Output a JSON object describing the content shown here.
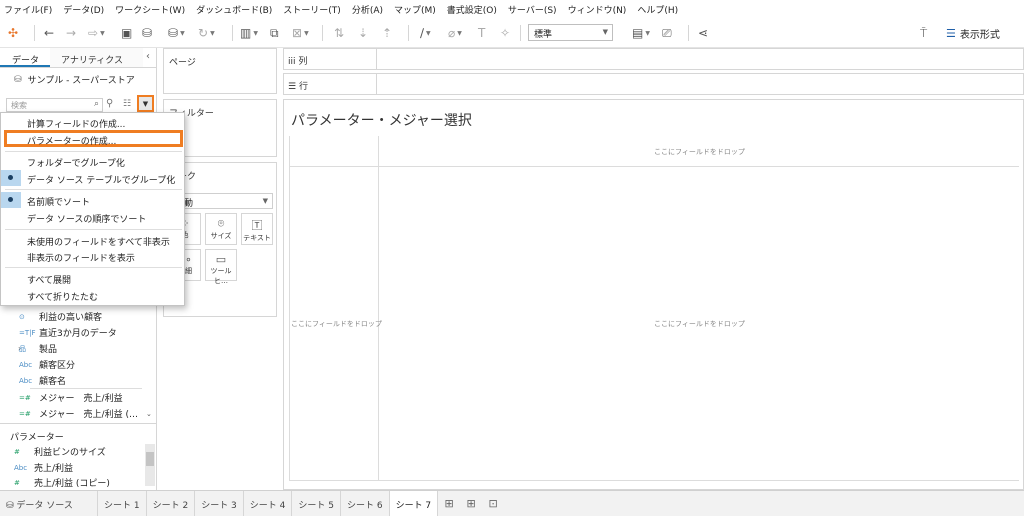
{
  "menubar": [
    "ファイル(F)",
    "データ(D)",
    "ワークシート(W)",
    "ダッシュボード(B)",
    "ストーリー(T)",
    "分析(A)",
    "マップ(M)",
    "書式設定(O)",
    "サーバー(S)",
    "ウィンドウ(N)",
    "ヘルプ(H)"
  ],
  "toolbar": {
    "standard": "標準",
    "display_format": "表示形式"
  },
  "left_panel": {
    "tab_data": "データ",
    "tab_analytics": "アナリティクス",
    "data_source": "サンプル - スーパーストア",
    "search_placeholder": "検索"
  },
  "fields": [
    {
      "icon": "⊙",
      "label": "利益の高い顧客"
    },
    {
      "icon": "=T|F",
      "label": "直近3か月のデータ"
    },
    {
      "icon": "品",
      "label": "製品"
    },
    {
      "icon": "Abc",
      "label": "顧客区分"
    },
    {
      "icon": "Abc",
      "label": "顧客名"
    },
    {
      "icon": "=#",
      "label": "メジャー　売上/利益"
    },
    {
      "icon": "=#",
      "label": "メジャー　売上/利益 (…"
    }
  ],
  "parameters": {
    "title": "パラメーター",
    "items": [
      {
        "icon": "#",
        "label": "利益ビンのサイズ"
      },
      {
        "icon": "Abc",
        "label": "売上/利益"
      },
      {
        "icon": "#",
        "label": "売上/利益 (コピー)"
      }
    ]
  },
  "cards": {
    "pages": "ページ",
    "filters": "フィルター",
    "marks": "マーク",
    "mark_type": "自動",
    "mark_buttons": [
      "色",
      "サイズ",
      "テキスト",
      "詳細",
      "ツールヒ…"
    ]
  },
  "shelves": {
    "columns": "列",
    "rows": "行"
  },
  "view": {
    "title": "パラメーター・メジャー選択",
    "drop_top": "ここにフィールドをドロップ",
    "drop_left": "ここにフィールドをドロップ",
    "drop_center": "ここにフィールドをドロップ"
  },
  "context_menu": {
    "calc_field": "計算フィールドの作成...",
    "create_parameter": "パラメーターの作成...",
    "group_by_folder": "フォルダーでグループ化",
    "group_by_table": "データ ソース テーブルでグループ化",
    "sort_by_name": "名前順でソート",
    "sort_by_source": "データ ソースの順序でソート",
    "hide_unused": "未使用のフィールドをすべて非表示",
    "show_hidden": "非表示のフィールドを表示",
    "expand_all": "すべて展開",
    "collapse_all": "すべて折りたたむ"
  },
  "bottom_tabs": {
    "data_source": "データ ソース",
    "sheets": [
      "シート 1",
      "シート 2",
      "シート 3",
      "シート 4",
      "シート 5",
      "シート 6",
      "シート 7"
    ]
  },
  "colors": {
    "accent": "#ef7d22",
    "highlight": "#b9d7ef"
  }
}
